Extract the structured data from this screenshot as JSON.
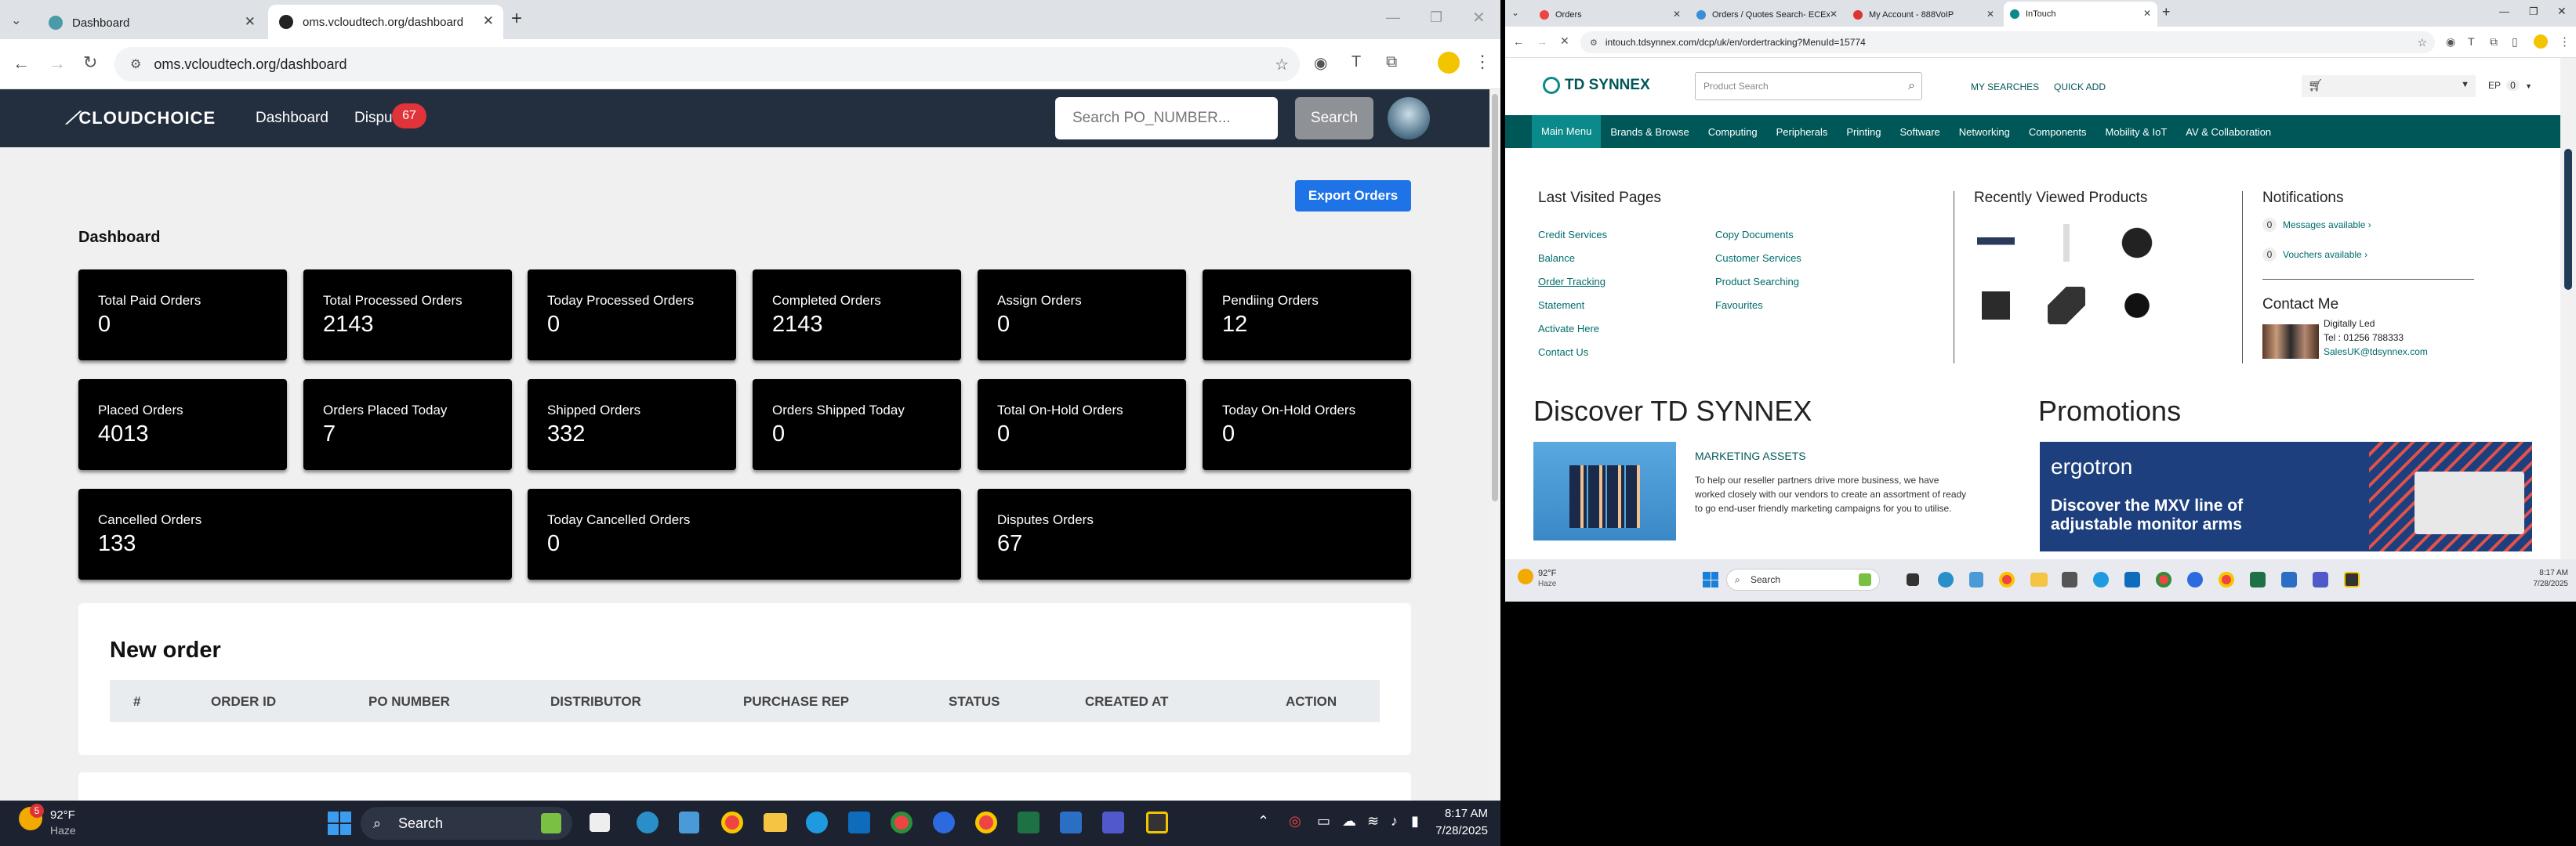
{
  "left": {
    "tabs": [
      {
        "label": "Dashboard",
        "active": false
      },
      {
        "label": "oms.vcloudtech.org/dashboard",
        "active": true
      }
    ],
    "url": "oms.vcloudtech.org/dashboard",
    "app": {
      "logo": "CLOUDCHOICE",
      "nav": [
        {
          "label": "Dashboard"
        },
        {
          "label": "Dispu",
          "badge": "67"
        }
      ],
      "search_placeholder": "Search PO_NUMBER...",
      "search_button": "Search",
      "export_button": "Export Orders",
      "dashboard_title": "Dashboard",
      "cards": [
        {
          "label": "Total Paid Orders",
          "value": "0"
        },
        {
          "label": "Total Processed Orders",
          "value": "2143"
        },
        {
          "label": "Today Processed Orders",
          "value": "0"
        },
        {
          "label": "Completed Orders",
          "value": "2143"
        },
        {
          "label": "Assign Orders",
          "value": "0"
        },
        {
          "label": "Pendiing Orders",
          "value": "12"
        },
        {
          "label": "Placed Orders",
          "value": "4013"
        },
        {
          "label": "Orders Placed Today",
          "value": "7"
        },
        {
          "label": "Shipped Orders",
          "value": "332"
        },
        {
          "label": "Orders Shipped Today",
          "value": "0"
        },
        {
          "label": "Total On-Hold Orders",
          "value": "0"
        },
        {
          "label": "Today On-Hold Orders",
          "value": "0"
        },
        {
          "label": "Cancelled Orders",
          "value": "133"
        },
        {
          "label": "Today Cancelled Orders",
          "value": "0"
        },
        {
          "label": "Disputes Orders",
          "value": "67"
        }
      ],
      "new_order": {
        "title": "New order",
        "columns": [
          "#",
          "ORDER ID",
          "PO NUMBER",
          "DISTRIBUTOR",
          "PURCHASE REP",
          "STATUS",
          "CREATED AT",
          "ACTION"
        ]
      }
    },
    "taskbar": {
      "weather_temp": "92°F",
      "weather_desc": "Haze",
      "weather_badge": "5",
      "search_label": "Search",
      "time": "8:17 AM",
      "date": "7/28/2025"
    }
  },
  "right": {
    "tabs": [
      {
        "label": "Orders"
      },
      {
        "label": "Orders / Quotes Search- ECExp"
      },
      {
        "label": "My Account - 888VoIP"
      },
      {
        "label": "InTouch",
        "active": true
      }
    ],
    "url": "intouch.tdsynnex.com/dcp/uk/en/ordertracking?MenuId=15774",
    "logo": "TD SYNNEX",
    "search_placeholder": "Product Search",
    "my_searches": "MY SEARCHES",
    "quick_add": "QUICK ADD",
    "account_initials": "EP",
    "account_count": "0",
    "menu": [
      "Main Menu",
      "Brands & Browse",
      "Computing",
      "Peripherals",
      "Printing",
      "Software",
      "Networking",
      "Components",
      "Mobility & IoT",
      "AV & Collaboration"
    ],
    "last_visited_title": "Last Visited Pages",
    "last_visited_col1": [
      "Credit Services",
      "Balance",
      "Order Tracking",
      "Statement",
      "Activate Here",
      "Contact Us"
    ],
    "last_visited_col2": [
      "Copy Documents",
      "Customer Services",
      "Product Searching",
      "Favourites"
    ],
    "recently_viewed_title": "Recently Viewed Products",
    "notifications_title": "Notifications",
    "notifications": [
      {
        "count": "0",
        "label": "Messages available"
      },
      {
        "count": "0",
        "label": "Vouchers available"
      }
    ],
    "contact_title": "Contact Me",
    "contact_name": "Digitally Led",
    "contact_tel": "Tel : 01256 788333",
    "contact_email": "SalesUK@tdsynnex.com",
    "discover_title": "Discover TD SYNNEX",
    "marketing_title": "MARKETING ASSETS",
    "marketing_text": "To help our reseller partners drive more business, we have worked closely with our vendors to create an assortment of ready to go end-user friendly marketing campaigns for you to utilise.",
    "promotions_title": "Promotions",
    "promo_brand": "ergotron",
    "promo_text": "Discover the MXV line of adjustable monitor arms",
    "taskbar": {
      "weather_temp": "92°F",
      "weather_desc": "Haze",
      "search_label": "Search",
      "time": "8:17 AM",
      "date": "7/28/2025"
    }
  }
}
